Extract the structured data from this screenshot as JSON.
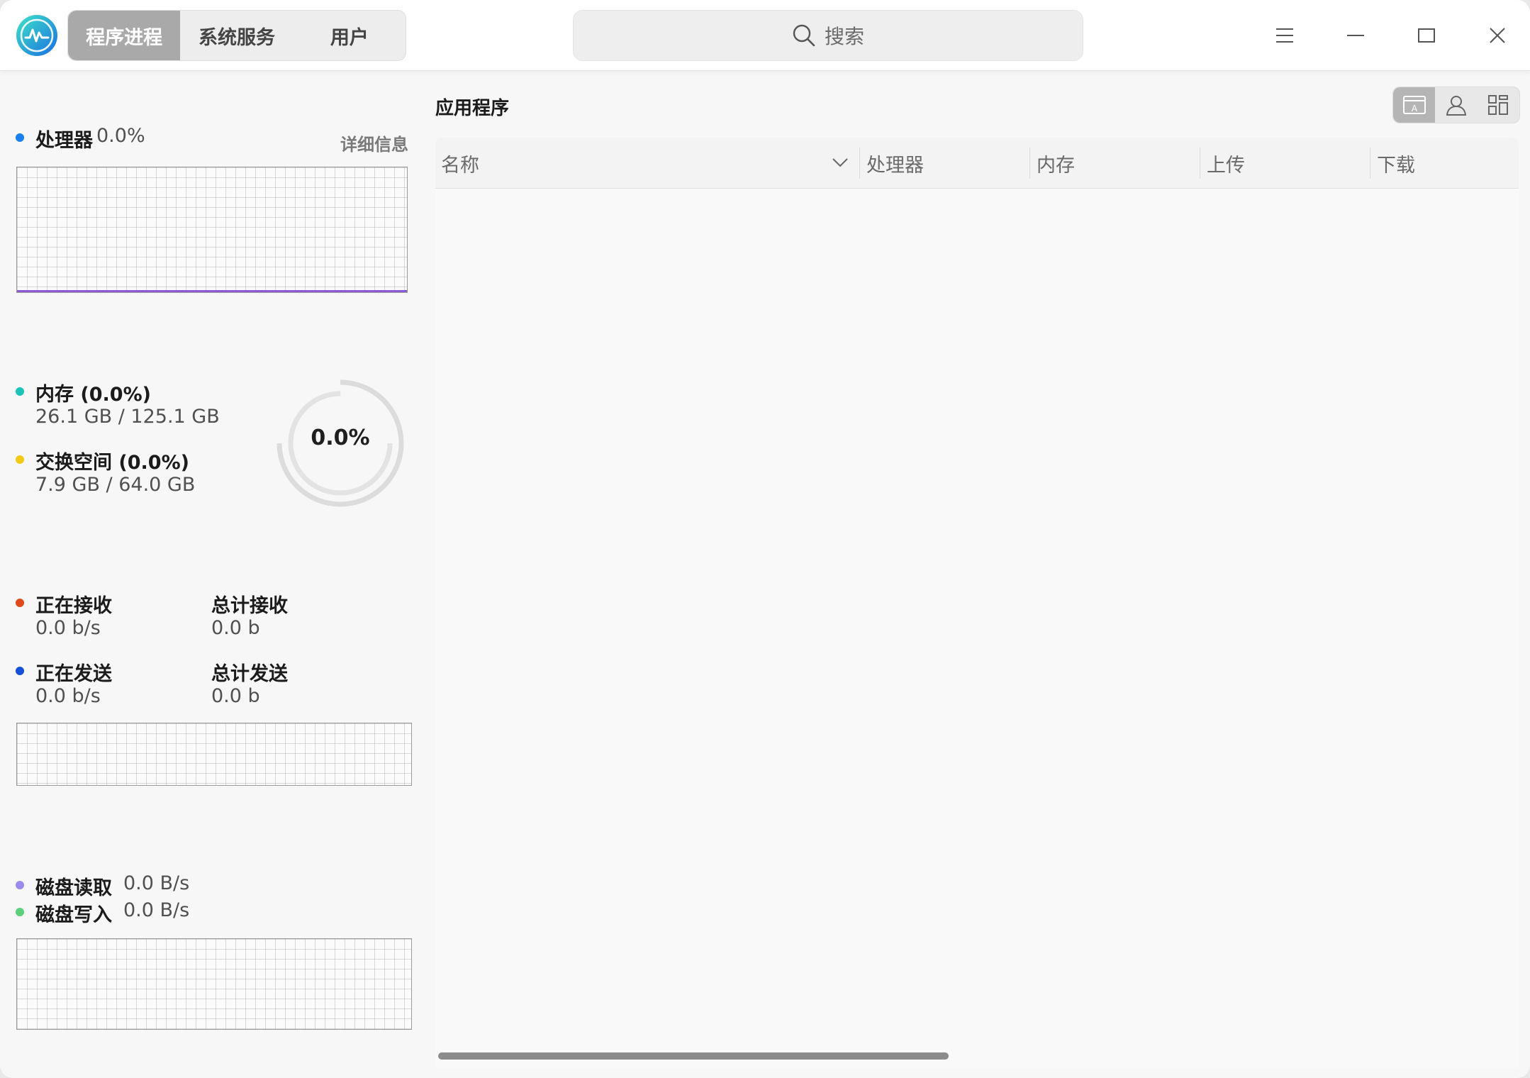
{
  "window": {
    "tabs": [
      "程序进程",
      "系统服务",
      "用户"
    ],
    "search_placeholder": "搜索"
  },
  "cpu": {
    "label": "处理器",
    "value": "0.0%",
    "detail_link": "详细信息",
    "color": "#1a7ff0"
  },
  "memory": {
    "mem_label": "内存 (0.0%)",
    "mem_value": "26.1 GB / 125.1 GB",
    "mem_color": "#1cc4b8",
    "swap_label": "交换空间 (0.0%)",
    "swap_value": "7.9 GB / 64.0 GB",
    "swap_color": "#f5c918",
    "ring_text": "0.0%"
  },
  "network": {
    "receiving_label": "正在接收",
    "receiving_value": "0.0 b/s",
    "receiving_color": "#e04a1a",
    "total_received_label": "总计接收",
    "total_received_value": "0.0 b",
    "sending_label": "正在发送",
    "sending_value": "0.0 b/s",
    "sending_color": "#1650d8",
    "total_sent_label": "总计发送",
    "total_sent_value": "0.0 b"
  },
  "disk": {
    "read_label": "磁盘读取",
    "read_value": "0.0 B/s",
    "read_color": "#9a8cef",
    "write_label": "磁盘写入",
    "write_value": "0.0 B/s",
    "write_color": "#5cd07a"
  },
  "apps": {
    "title": "应用程序",
    "columns": [
      "名称",
      "处理器",
      "内存",
      "上传",
      "下载"
    ]
  }
}
